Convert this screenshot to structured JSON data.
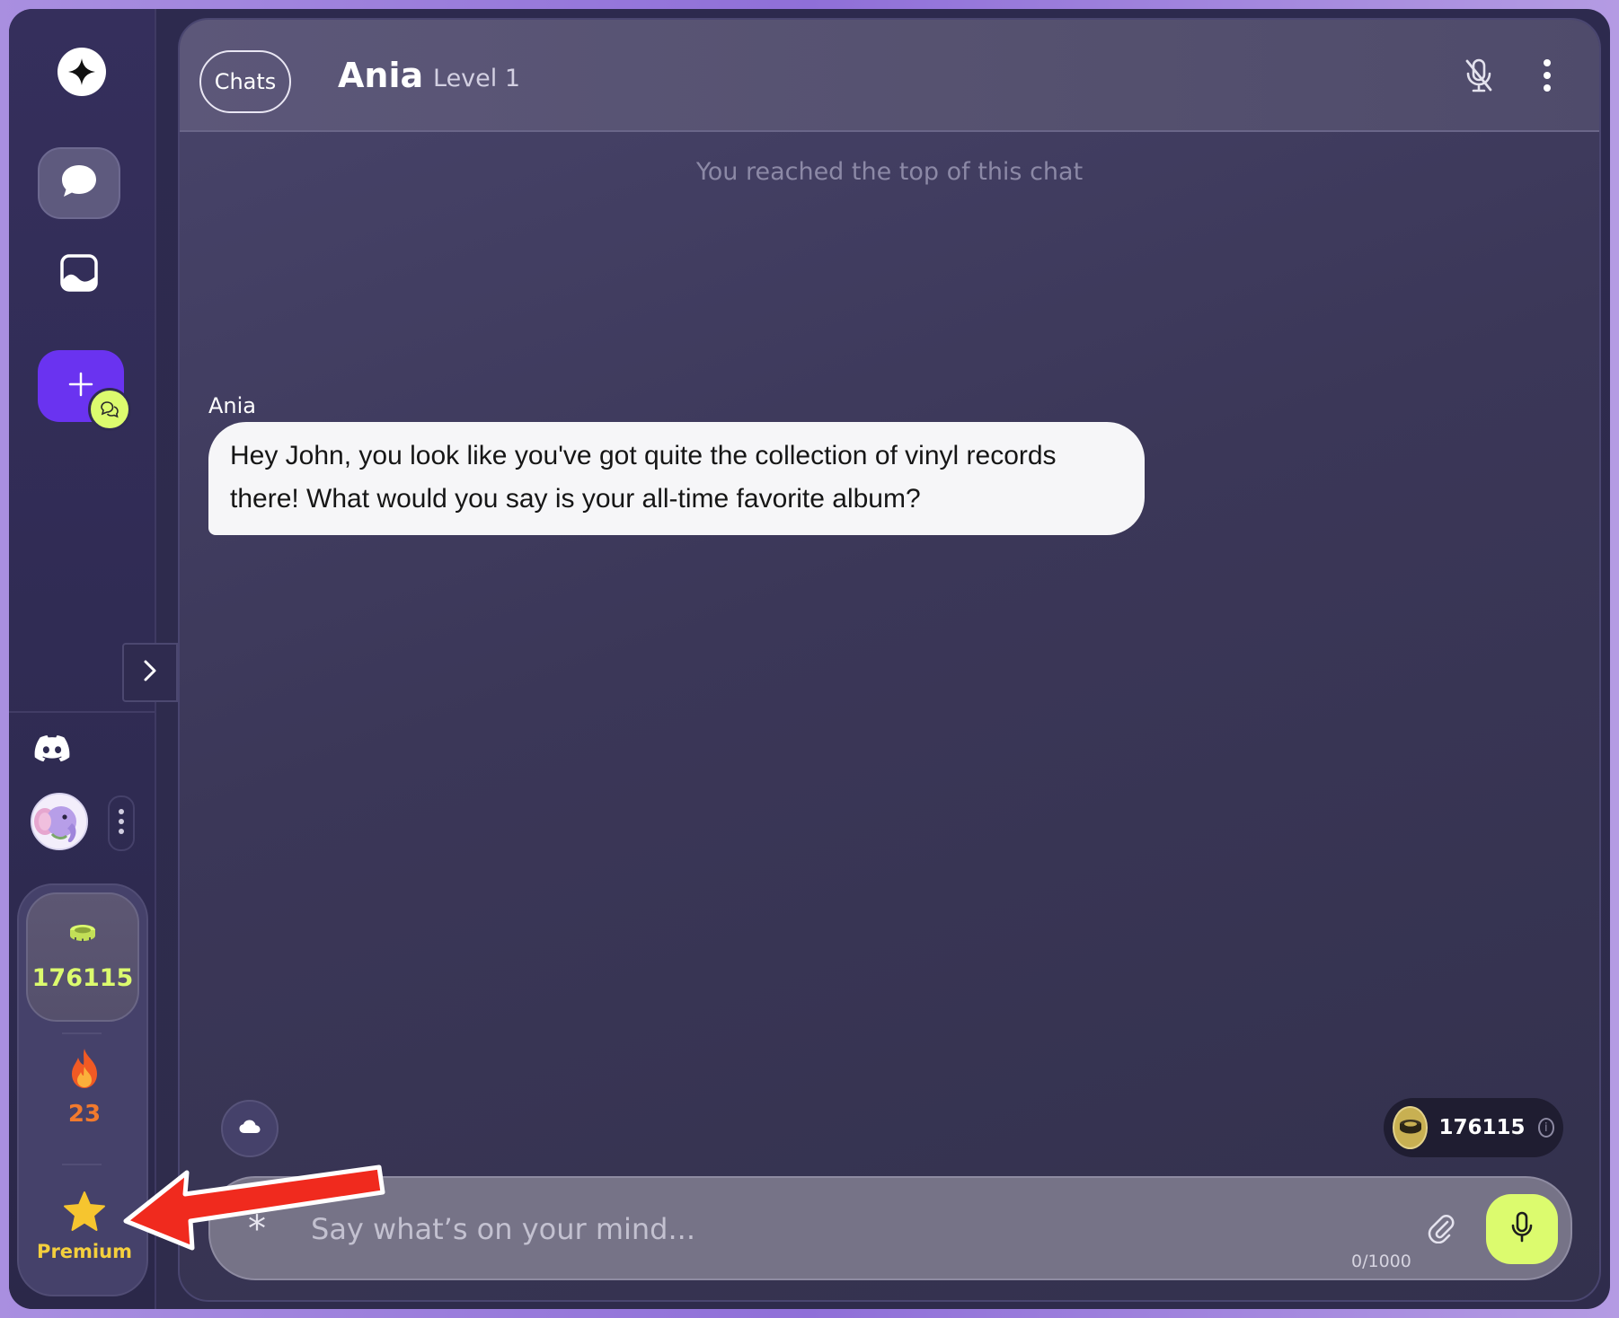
{
  "sidebar": {
    "logo_icon": "sparkle-icon",
    "nav": [
      {
        "name": "chats",
        "icon": "chat-bubble-icon",
        "active": true
      },
      {
        "name": "gallery",
        "icon": "image-icon",
        "active": false
      }
    ],
    "new_chat_icon": "plus-icon",
    "new_chat_badge_icon": "chats-icon",
    "expand_icon": "chevron-right-icon",
    "discord_icon": "discord-icon",
    "avatar_icon": "elephant-avatar",
    "coins": {
      "icon": "coins-icon",
      "value": "176115"
    },
    "streak": {
      "icon": "fire-icon",
      "value": "23"
    },
    "premium": {
      "icon": "star-icon",
      "label": "Premium"
    }
  },
  "header": {
    "chats_button": "Chats",
    "character_name": "Ania",
    "level": "Level 1",
    "mic_icon": "mic-off-icon",
    "menu_icon": "more-vertical-icon"
  },
  "chat": {
    "top_notice": "You reached the top of this chat",
    "messages": [
      {
        "author": "Ania",
        "text": "Hey John, you look like you've got quite the collection of vinyl records there! What would you say is your all-time favorite album?"
      }
    ]
  },
  "composer": {
    "placeholder": "Say what’s on your mind...",
    "value": "",
    "char_count": "0/1000",
    "balance": "176115",
    "asterisk_label": "*"
  },
  "colors": {
    "accent_lime": "#dcfb6e",
    "accent_purple": "#6a33f0",
    "streak_orange": "#f27a2d",
    "premium_gold": "#f4cf3d"
  }
}
